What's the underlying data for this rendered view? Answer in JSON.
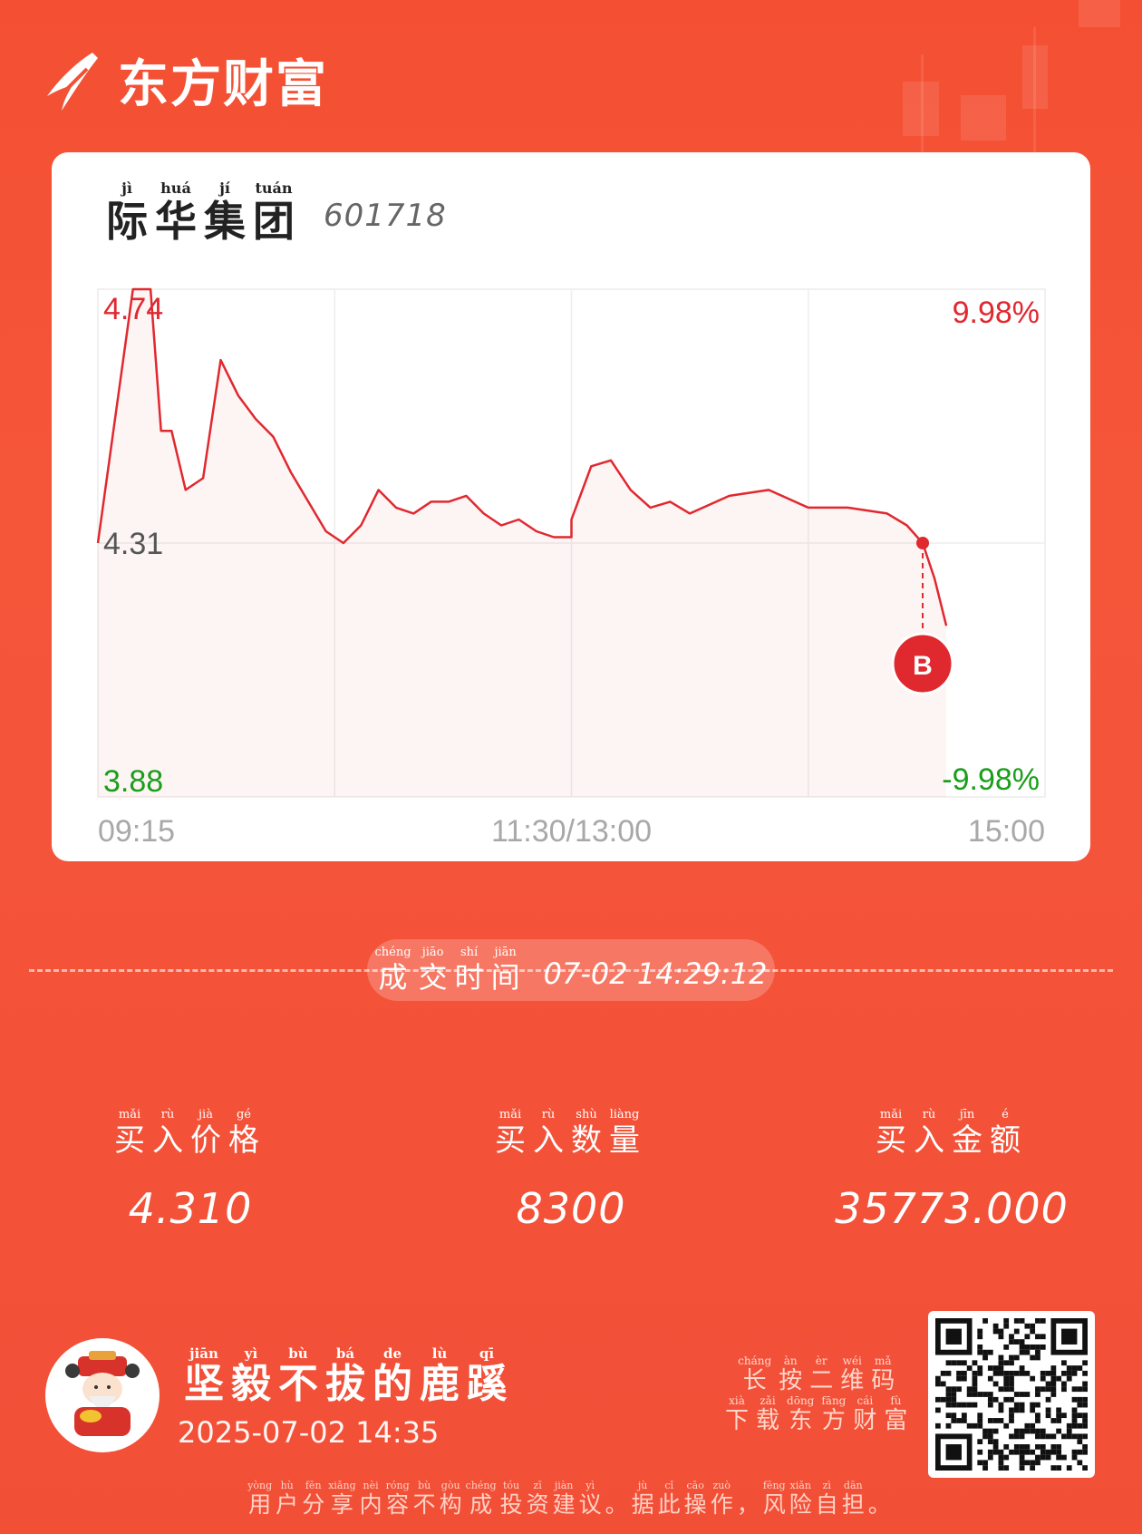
{
  "brand": {
    "name": "东方财富"
  },
  "stock": {
    "name_chars": [
      {
        "py": "jì",
        "hz": "际"
      },
      {
        "py": "huá",
        "hz": "华"
      },
      {
        "py": "jí",
        "hz": "集"
      },
      {
        "py": "tuán",
        "hz": "团"
      }
    ],
    "code": "601718"
  },
  "chart_data": {
    "type": "line",
    "title": "",
    "x_ticks": [
      "09:15",
      "11:30/13:00",
      "15:00"
    ],
    "y_left_ticks": [
      "4.74",
      "4.31",
      "3.88"
    ],
    "y_right_ticks": [
      "9.98%",
      "-9.98%"
    ],
    "ylim": [
      3.88,
      4.74
    ],
    "prev_close": 4.31,
    "colors": {
      "line": "#e0282f",
      "up": "#e0282f",
      "down": "#1a9e1a",
      "neutral": "#555555"
    },
    "series": [
      {
        "x": [
          "09:15",
          "09:25",
          "09:30",
          "09:33",
          "09:36",
          "09:40",
          "09:45",
          "09:50",
          "09:55",
          "10:00",
          "10:05",
          "10:10",
          "10:15",
          "10:20",
          "10:25",
          "10:30",
          "10:35",
          "10:40",
          "10:45",
          "10:50",
          "10:55",
          "11:00",
          "11:05",
          "11:10",
          "11:15",
          "11:20",
          "11:25",
          "11:30",
          "13:00",
          "13:05",
          "13:10",
          "13:15",
          "13:20",
          "13:25",
          "13:30",
          "13:40",
          "13:50",
          "14:00",
          "14:10",
          "14:20",
          "14:25",
          "14:29",
          "14:32",
          "14:35"
        ],
        "values": [
          4.31,
          4.74,
          4.74,
          4.5,
          4.5,
          4.4,
          4.42,
          4.62,
          4.56,
          4.52,
          4.49,
          4.43,
          4.38,
          4.33,
          4.31,
          4.34,
          4.4,
          4.37,
          4.36,
          4.38,
          4.38,
          4.39,
          4.36,
          4.34,
          4.35,
          4.33,
          4.32,
          4.32,
          4.35,
          4.44,
          4.45,
          4.4,
          4.37,
          4.38,
          4.36,
          4.39,
          4.4,
          4.37,
          4.37,
          4.36,
          4.34,
          4.31,
          4.25,
          4.17
        ]
      }
    ],
    "marker": {
      "label": "B",
      "time": "14:29",
      "price": 4.31
    }
  },
  "trade": {
    "time_label_chars": [
      {
        "py": "chéng",
        "hz": "成"
      },
      {
        "py": "jiāo",
        "hz": "交"
      },
      {
        "py": "shí",
        "hz": "时"
      },
      {
        "py": "jiān",
        "hz": "间"
      }
    ],
    "time_value": "07-02 14:29:12"
  },
  "stats": [
    {
      "label_chars": [
        {
          "py": "mǎi",
          "hz": "买"
        },
        {
          "py": "rù",
          "hz": "入"
        },
        {
          "py": "jià",
          "hz": "价"
        },
        {
          "py": "gé",
          "hz": "格"
        }
      ],
      "value": "4.310"
    },
    {
      "label_chars": [
        {
          "py": "mǎi",
          "hz": "买"
        },
        {
          "py": "rù",
          "hz": "入"
        },
        {
          "py": "shù",
          "hz": "数"
        },
        {
          "py": "liàng",
          "hz": "量"
        }
      ],
      "value": "8300"
    },
    {
      "label_chars": [
        {
          "py": "mǎi",
          "hz": "买"
        },
        {
          "py": "rù",
          "hz": "入"
        },
        {
          "py": "jīn",
          "hz": "金"
        },
        {
          "py": "é",
          "hz": "额"
        }
      ],
      "value": "35773.000"
    }
  ],
  "user": {
    "name_chars": [
      {
        "py": "jiān",
        "hz": "坚"
      },
      {
        "py": "yì",
        "hz": "毅"
      },
      {
        "py": "bù",
        "hz": "不"
      },
      {
        "py": "bá",
        "hz": "拔"
      },
      {
        "py": "de",
        "hz": "的"
      },
      {
        "py": "lù",
        "hz": "鹿"
      },
      {
        "py": "qī",
        "hz": "蹊"
      }
    ],
    "post_time": "2025-07-02 14:35"
  },
  "qr_hint": {
    "line1": [
      {
        "py": "cháng",
        "hz": "长"
      },
      {
        "py": "àn",
        "hz": "按"
      },
      {
        "py": "èr",
        "hz": "二"
      },
      {
        "py": "wéi",
        "hz": "维"
      },
      {
        "py": "mǎ",
        "hz": "码"
      }
    ],
    "line2": [
      {
        "py": "xià",
        "hz": "下"
      },
      {
        "py": "zǎi",
        "hz": "载"
      },
      {
        "py": "dōng",
        "hz": "东"
      },
      {
        "py": "fāng",
        "hz": "方"
      },
      {
        "py": "cái",
        "hz": "财"
      },
      {
        "py": "fù",
        "hz": "富"
      }
    ]
  },
  "disclaimer_chars": [
    {
      "py": "yòng",
      "hz": "用"
    },
    {
      "py": "hù",
      "hz": "户"
    },
    {
      "py": "fēn",
      "hz": "分"
    },
    {
      "py": "xiǎng",
      "hz": "享"
    },
    {
      "py": "nèi",
      "hz": "内"
    },
    {
      "py": "róng",
      "hz": "容"
    },
    {
      "py": "bù",
      "hz": "不"
    },
    {
      "py": "gòu",
      "hz": "构"
    },
    {
      "py": "chéng",
      "hz": "成"
    },
    {
      "py": "tóu",
      "hz": "投"
    },
    {
      "py": "zī",
      "hz": "资"
    },
    {
      "py": "jiàn",
      "hz": "建"
    },
    {
      "py": "yì",
      "hz": "议"
    },
    {
      "py": "",
      "hz": "。"
    },
    {
      "py": "jù",
      "hz": "据"
    },
    {
      "py": "cǐ",
      "hz": "此"
    },
    {
      "py": "cāo",
      "hz": "操"
    },
    {
      "py": "zuò",
      "hz": "作"
    },
    {
      "py": "",
      "hz": "，"
    },
    {
      "py": "fēng",
      "hz": "风"
    },
    {
      "py": "xiǎn",
      "hz": "险"
    },
    {
      "py": "zì",
      "hz": "自"
    },
    {
      "py": "dān",
      "hz": "担"
    },
    {
      "py": "",
      "hz": "。"
    }
  ]
}
